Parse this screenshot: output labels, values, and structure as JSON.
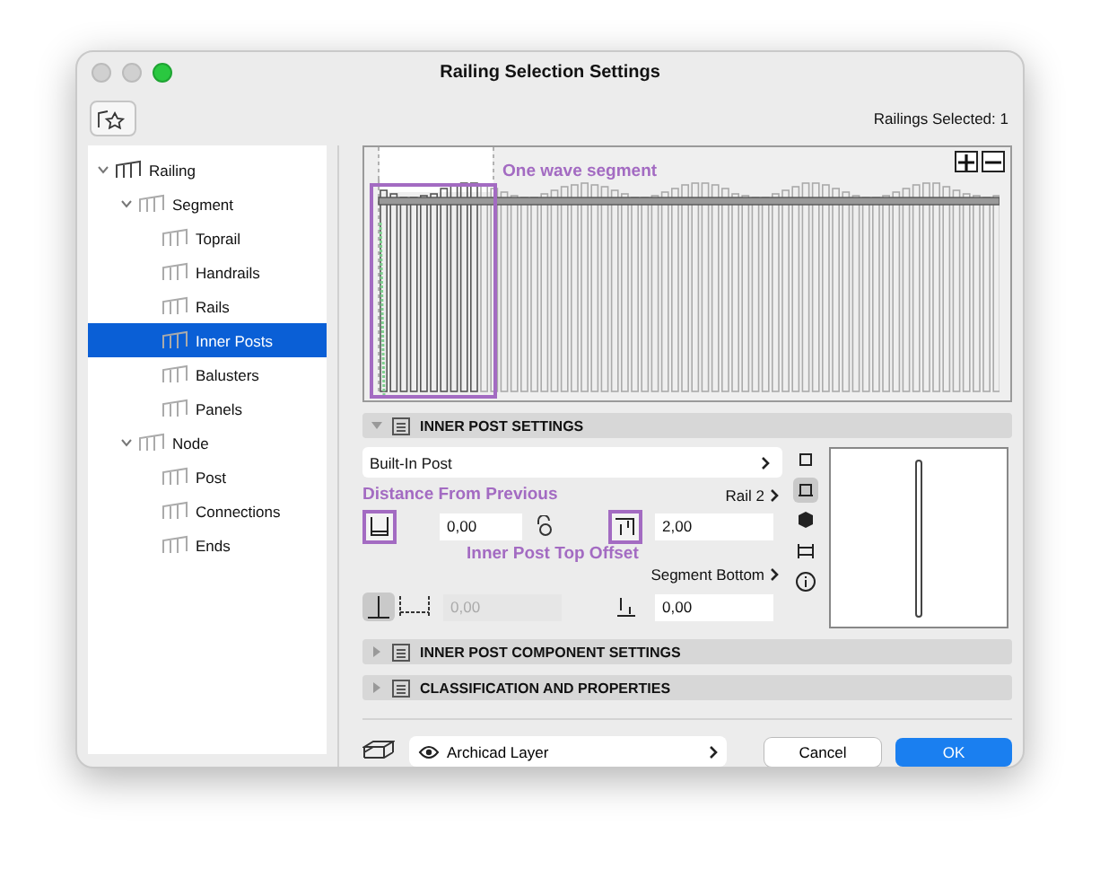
{
  "window": {
    "title": "Railing Selection Settings"
  },
  "toolbar": {
    "status": "Railings Selected: 1"
  },
  "tree": [
    {
      "label": "Railing",
      "expanded": true,
      "selected": false,
      "children": [
        {
          "label": "Segment",
          "expanded": true,
          "selected": false,
          "children": [
            {
              "label": "Toprail",
              "selected": false
            },
            {
              "label": "Handrails",
              "selected": false
            },
            {
              "label": "Rails",
              "selected": false
            },
            {
              "label": "Inner Posts",
              "selected": true
            },
            {
              "label": "Balusters",
              "selected": false
            },
            {
              "label": "Panels",
              "selected": false
            }
          ]
        },
        {
          "label": "Node",
          "expanded": true,
          "selected": false,
          "children": [
            {
              "label": "Post",
              "selected": false
            },
            {
              "label": "Connections",
              "selected": false
            },
            {
              "label": "Ends",
              "selected": false
            }
          ]
        }
      ]
    }
  ],
  "preview": {
    "annotation": "One wave segment"
  },
  "sections": [
    {
      "title": "INNER POST SETTINGS",
      "expanded": true
    },
    {
      "title": "INNER POST COMPONENT SETTINGS",
      "expanded": false
    },
    {
      "title": "CLASSIFICATION AND PROPERTIES",
      "expanded": false
    }
  ],
  "inner_post": {
    "type_dropdown": "Built-In Post",
    "distance_annotation": "Distance From Previous",
    "rail_link": "Rail 2",
    "distance_value": "0,00",
    "top_offset_value": "2,00",
    "top_offset_annotation": "Inner Post Top Offset",
    "bottom_link": "Segment Bottom",
    "spacing_value": "0,00",
    "spacing_disabled": true,
    "bottom_offset_value": "0,00",
    "view_buttons": [
      {
        "selected": false
      },
      {
        "selected": true
      },
      {
        "selected": false
      },
      {
        "selected": false
      },
      {
        "selected": false
      }
    ]
  },
  "footer": {
    "layer": "Archicad Layer",
    "buttons": [
      {
        "label": "Cancel",
        "kind": "secondary"
      },
      {
        "label": "OK",
        "kind": "primary"
      }
    ]
  }
}
